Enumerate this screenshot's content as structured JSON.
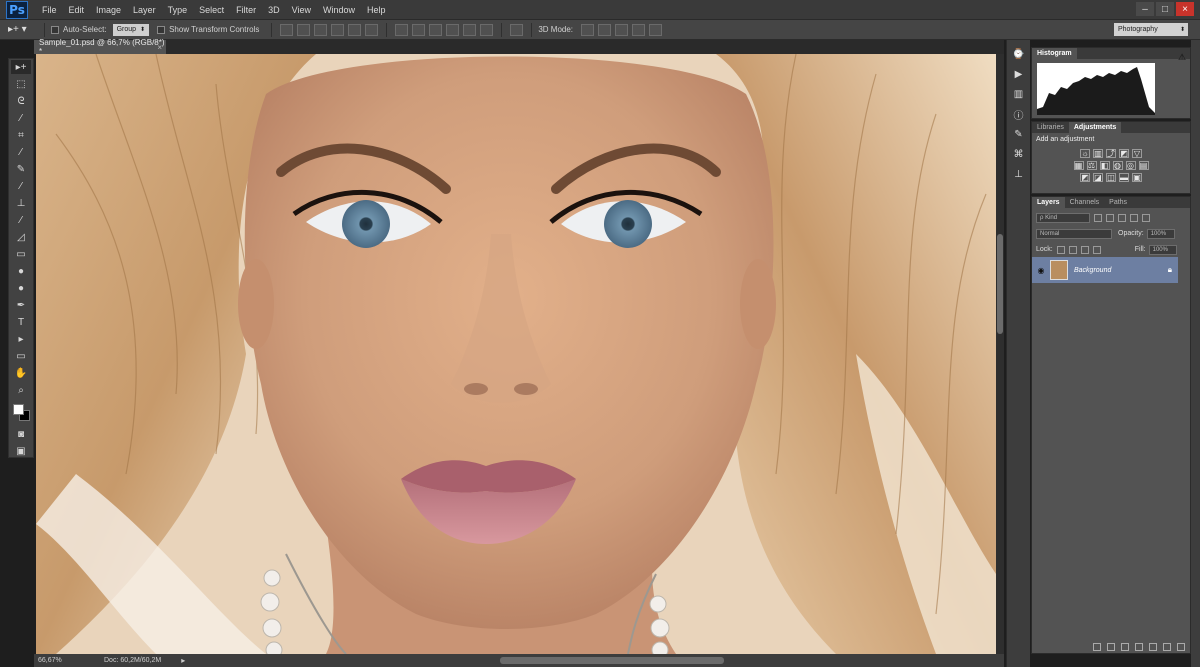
{
  "app": {
    "logo": "Ps",
    "menu": [
      "File",
      "Edit",
      "Image",
      "Layer",
      "Type",
      "Select",
      "Filter",
      "3D",
      "View",
      "Window",
      "Help"
    ],
    "workspace": "Photography"
  },
  "options": {
    "auto_select_label": "Auto-Select:",
    "auto_select_value": "Group",
    "transform_label": "Show Transform Controls",
    "mode_label": "3D Mode:"
  },
  "document": {
    "tab_title": "Sample_01.psd @ 66,7% (RGB/8*) *",
    "zoom": "66,67%",
    "doc_size": "Doc: 60,2M/60,2M"
  },
  "panels": {
    "histogram_tab": "Histogram",
    "libraries_tab": "Libraries",
    "adjustments_tab": "Adjustments",
    "adjustments_title": "Add an adjustment",
    "layers_tab": "Layers",
    "channels_tab": "Channels",
    "paths_tab": "Paths",
    "kind_label": "Kind",
    "blend_mode": "Normal",
    "opacity_label": "Opacity:",
    "opacity_value": "100%",
    "lock_label": "Lock:",
    "fill_label": "Fill:",
    "fill_value": "100%",
    "layer_name": "Background"
  }
}
